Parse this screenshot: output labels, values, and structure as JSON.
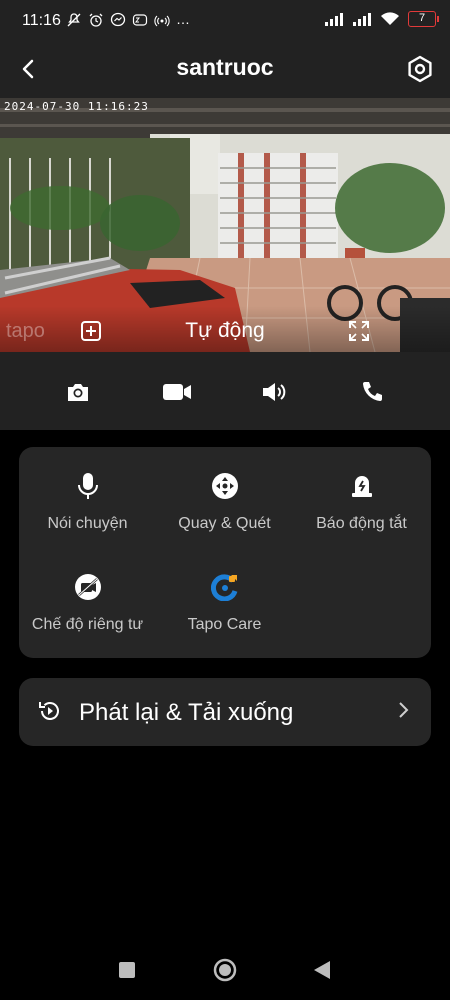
{
  "status_bar": {
    "time": "11:16",
    "battery": "7",
    "more_indicator": "…",
    "battery_color": "#e23a3a"
  },
  "header": {
    "title": "santruoc",
    "back_icon": "back-arrow-icon",
    "settings_icon": "settings-hexagon-icon"
  },
  "feed": {
    "timestamp": "2024-07-30 11:16:23",
    "mode_label": "Tự động",
    "overlay_watermark": "tapo"
  },
  "controls": [
    {
      "name": "snapshot",
      "icon": "camera-icon"
    },
    {
      "name": "record",
      "icon": "video-camera-icon"
    },
    {
      "name": "sound",
      "icon": "speaker-icon"
    },
    {
      "name": "call",
      "icon": "phone-icon"
    }
  ],
  "features": [
    {
      "label": "Nói chuyện",
      "icon": "microphone-icon"
    },
    {
      "label": "Quay & Quét",
      "icon": "pan-tilt-icon"
    },
    {
      "label": "Báo động tắt",
      "icon": "alarm-off-icon"
    },
    {
      "label": "Chế độ riêng tư",
      "icon": "privacy-icon"
    },
    {
      "label": "Tapo Care",
      "icon": "tapo-care-icon"
    }
  ],
  "playback": {
    "label": "Phát lại & Tải xuống"
  },
  "colors": {
    "surface": "#262626",
    "bar": "#222222",
    "tapo_care_blue": "#1d7fd6",
    "tapo_care_orange": "#f5a623"
  }
}
